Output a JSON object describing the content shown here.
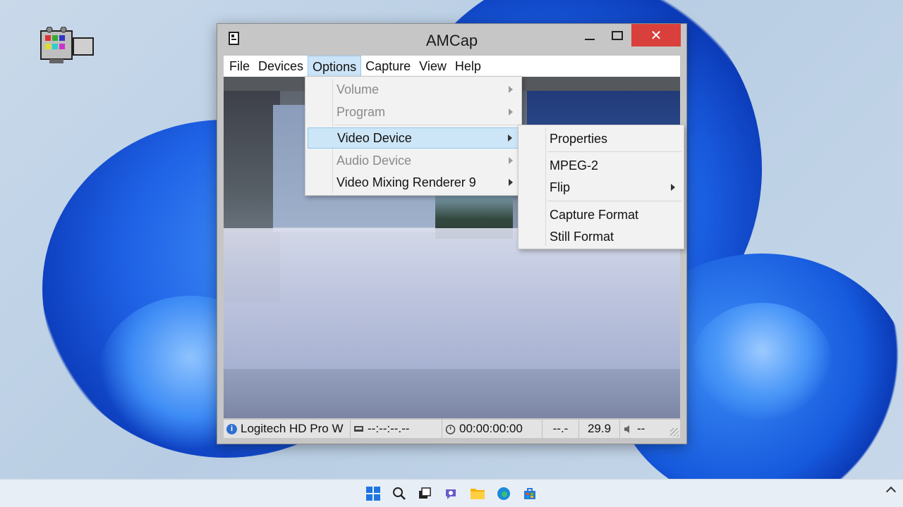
{
  "window": {
    "title": "AMCap"
  },
  "menubar": [
    {
      "label": "File",
      "active": false
    },
    {
      "label": "Devices",
      "active": false
    },
    {
      "label": "Options",
      "active": true
    },
    {
      "label": "Capture",
      "active": false
    },
    {
      "label": "View",
      "active": false
    },
    {
      "label": "Help",
      "active": false
    }
  ],
  "options_menu": {
    "items": [
      {
        "label": "Volume",
        "disabled": true,
        "submenu": true
      },
      {
        "label": "Program",
        "disabled": true,
        "submenu": true
      },
      {
        "label": "Video Device",
        "disabled": false,
        "submenu": true,
        "highlighted": true
      },
      {
        "label": "Audio Device",
        "disabled": true,
        "submenu": true
      },
      {
        "label": "Video Mixing Renderer 9",
        "disabled": false,
        "submenu": true
      }
    ]
  },
  "video_device_submenu": {
    "items": [
      {
        "label": "Properties",
        "submenu": false
      },
      {
        "label": "MPEG-2",
        "submenu": false
      },
      {
        "label": "Flip",
        "submenu": true
      },
      {
        "label": "Capture Format",
        "submenu": false
      },
      {
        "label": "Still Format",
        "submenu": false
      }
    ]
  },
  "statusbar": {
    "device": "Logitech HD Pro W",
    "timecode": "--:--:--.--",
    "elapsed": "00:00:00:00",
    "dropped": "--.-",
    "fps": "29.9",
    "volume": "--"
  },
  "taskbar": {
    "icons": [
      "start-icon",
      "search-icon",
      "task-view-icon",
      "chat-icon",
      "file-explorer-icon",
      "edge-icon",
      "store-icon"
    ]
  },
  "colors": {
    "close_button": "#d9403b",
    "menu_highlight": "#cde6f7",
    "accent": "#1f62e6"
  }
}
